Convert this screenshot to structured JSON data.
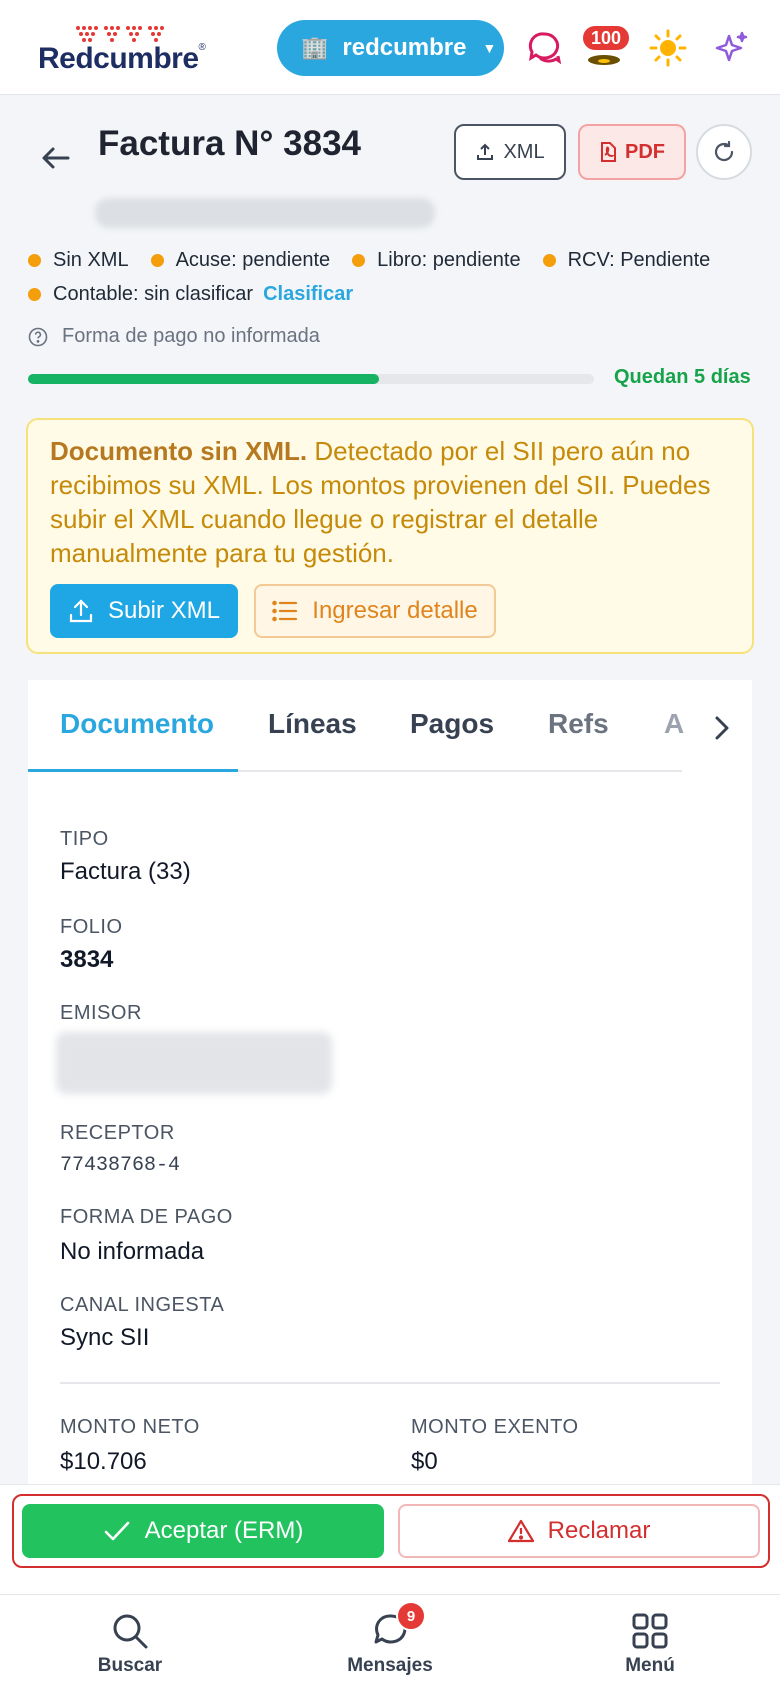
{
  "header": {
    "logo_text": "Redcumbre",
    "logo_mark": "®",
    "org_name": "redcumbre",
    "notifications_badge": "100",
    "icons": [
      "chat-icon",
      "notifications-icon",
      "theme-sun-icon",
      "ai-sparkles-icon"
    ]
  },
  "document": {
    "title": "Factura N° 3834",
    "xml_button": "XML",
    "pdf_button": "PDF",
    "statuses": {
      "xml": "Sin XML",
      "acuse": "Acuse: pendiente",
      "libro": "Libro: pendiente",
      "rcv": "RCV: Pendiente",
      "contable": "Contable: sin clasificar",
      "classify_link": "Clasificar"
    },
    "payment_note": "Forma de pago no informada",
    "progress_fraction": 0.62,
    "remaining_text": "Quedan 5 días",
    "colors": {
      "accent": "#2aa7df",
      "success": "#16a34a",
      "warning": "#f59e0b",
      "danger": "#d32f2f"
    }
  },
  "alert": {
    "title": "Documento sin XML.",
    "body": "Detectado por el SII pero aún no recibimos su XML. Los montos provienen del SII. Puedes subir el XML cuando llegue o registrar el detalle manualmente para tu gestión.",
    "upload_button": "Subir XML",
    "detail_button": "Ingresar detalle"
  },
  "tabs": {
    "documento": "Documento",
    "lineas": "Líneas",
    "pagos": "Pagos",
    "refs": "Refs",
    "next_partial": "A"
  },
  "fields": {
    "tipo_label": "TIPO",
    "tipo_value": "Factura (33)",
    "folio_label": "FOLIO",
    "folio_value": "3834",
    "emisor_label": "EMISOR",
    "receptor_label": "RECEPTOR",
    "receptor_value": "77438768-4",
    "forma_pago_label": "FORMA DE PAGO",
    "forma_pago_value": "No informada",
    "canal_label": "CANAL INGESTA",
    "canal_value": "Sync SII",
    "monto_neto_label": "MONTO NETO",
    "monto_neto_value": "$10.706",
    "monto_exento_label": "MONTO EXENTO",
    "monto_exento_value": "$0"
  },
  "actions": {
    "accept": "Aceptar (ERM)",
    "claim": "Reclamar"
  },
  "bottom_nav": {
    "search": "Buscar",
    "messages": "Mensajes",
    "messages_badge": "9",
    "menu": "Menú"
  }
}
